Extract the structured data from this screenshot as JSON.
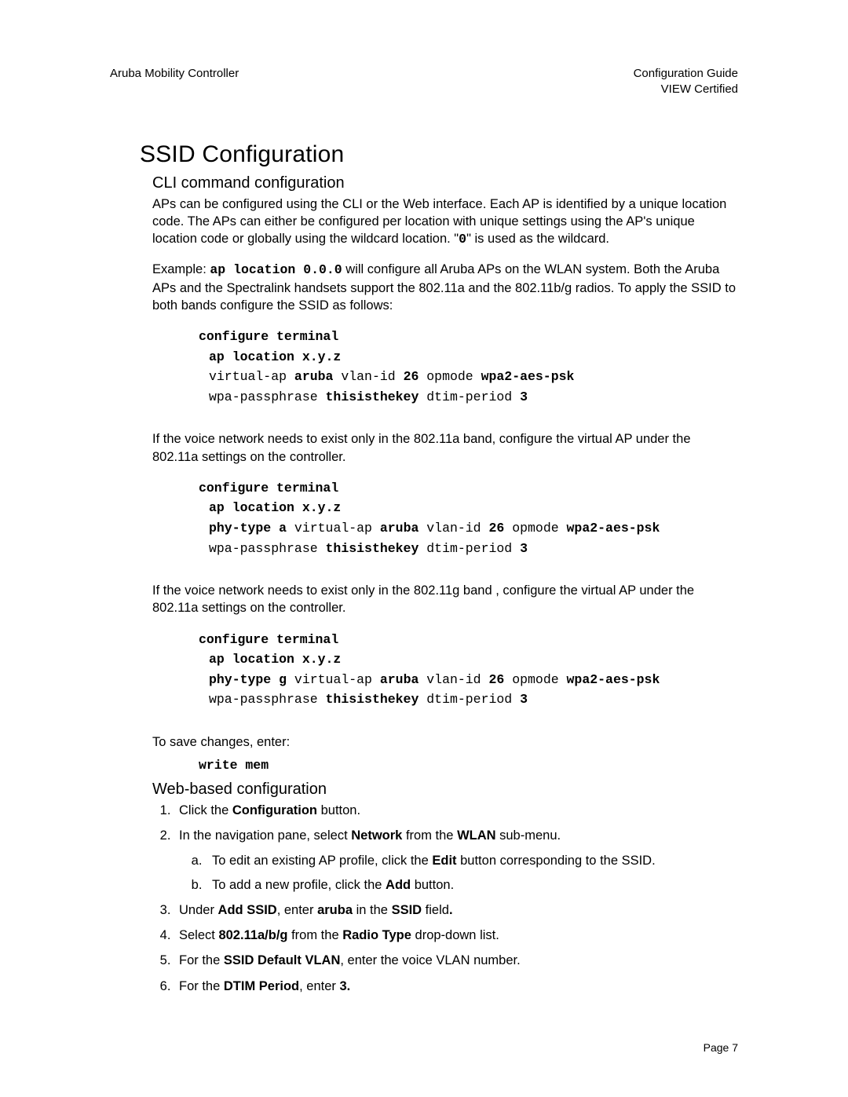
{
  "header": {
    "left": "Aruba Mobility Controller",
    "right_line1": "Configuration Guide",
    "right_line2": "VIEW Certified"
  },
  "h1": "SSID Configuration",
  "sec1": {
    "h2": "CLI command configuration",
    "p1a": "APs can be configured using the CLI or the Web interface. Each AP is identified by a unique location code. The APs can either be configured per location with unique settings using the AP's unique location code or globally using the wildcard location. \"",
    "p1_wild": "0",
    "p1b": "\" is used as the wildcard.",
    "p2a": "Example: ",
    "p2_cmd": "ap location 0.0.0",
    "p2b": " will configure all Aruba APs on the WLAN system.  Both the Aruba APs and the Spectralink handsets support the 802.11a and the 802.11b/g radios. To apply the SSID to both bands configure the SSID as follows:",
    "code1": {
      "l1": "configure terminal",
      "l2": "ap location x.y.z",
      "l3a": "virtual-ap ",
      "l3b": "aruba",
      "l3c": " vlan-id ",
      "l3d": "26",
      "l3e": " opmode ",
      "l3f": "wpa2-aes-psk",
      "l4a": "wpa-passphrase ",
      "l4b": "thisisthekey",
      "l4c": "  dtim-period ",
      "l4d": "3"
    },
    "p3": "If the voice network needs to exist only in the 802.11a band, configure the virtual AP under the 802.11a settings on the controller.",
    "code2": {
      "l1": "configure terminal",
      "l2": "ap location x.y.z",
      "l3a": "phy-type a",
      "l3b": " virtual-ap ",
      "l3c": "aruba",
      "l3d": " vlan-id ",
      "l3e": "26",
      "l3f": " opmode ",
      "l3g": "wpa2-aes-psk",
      "l4a": "wpa-passphrase ",
      "l4b": "thisisthekey",
      "l4c": "  dtim-period ",
      "l4d": "3"
    },
    "p4": "If the voice network needs to exist only in the 802.11g band , configure the virtual AP under the 802.11a settings on the controller.",
    "code3": {
      "l1": "configure terminal",
      "l2": "ap location x.y.z",
      "l3a": "phy-type g",
      "l3b": " virtual-ap ",
      "l3c": "aruba",
      "l3d": " vlan-id ",
      "l3e": "26",
      "l3f": " opmode ",
      "l3g": "wpa2-aes-psk",
      "l4a": "wpa-passphrase ",
      "l4b": "thisisthekey",
      "l4c": "  dtim-period ",
      "l4d": "3"
    },
    "p5": "To save changes, enter:",
    "code4": {
      "l1": "write mem"
    }
  },
  "sec2": {
    "h2": "Web-based configuration",
    "s1a": "Click the ",
    "s1b": "Configuration",
    "s1c": " button.",
    "s2a": "In the navigation pane, select ",
    "s2b": "Network",
    "s2c": " from the ",
    "s2d": "WLAN",
    "s2e": " sub-menu.",
    "s2a_a": "To edit an existing AP profile, click the ",
    "s2a_b": "Edit",
    "s2a_c": " button corresponding to the SSID.",
    "s2b_a": "To add a new profile, click the ",
    "s2b_b": "Add",
    "s2b_c": " button.",
    "s3a": "Under ",
    "s3b": "Add SSID",
    "s3c": ", enter ",
    "s3d": "aruba",
    "s3e": " in the ",
    "s3f": "SSID",
    "s3g": " field",
    "s3h": ".",
    "s4a": "Select ",
    "s4b": "802.11a/b/g",
    "s4c": " from the ",
    "s4d": "Radio Type",
    "s4e": " drop-down list.",
    "s5a": "For the ",
    "s5b": "SSID Default VLAN",
    "s5c": ", enter the voice VLAN number.",
    "s6a": "For the ",
    "s6b": "DTIM Period",
    "s6c": ", enter ",
    "s6d": "3.",
    "s6e": ""
  },
  "footer": {
    "page": "Page 7"
  }
}
